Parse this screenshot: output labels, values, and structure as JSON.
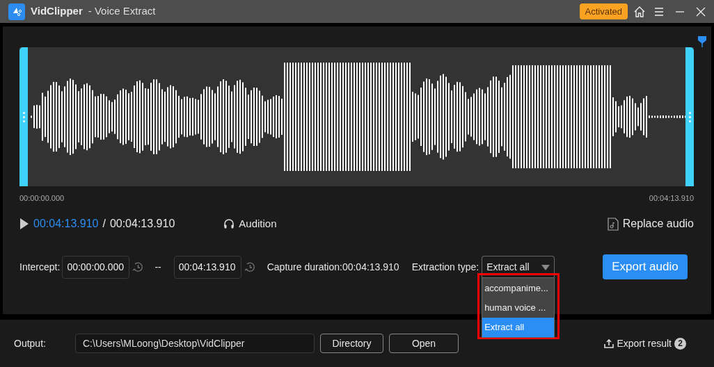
{
  "title_bar": {
    "app_name": "VidClipper",
    "subtitle": "- Voice Extract",
    "badge": "Activated"
  },
  "waveform": {
    "start_time": "00:00:00.000",
    "end_time": "00:04:13.910"
  },
  "playback": {
    "current": "00:04:13.910",
    "separator": "/",
    "total": "00:04:13.910",
    "audition": "Audition",
    "replace_audio": "Replace audio"
  },
  "intercept": {
    "label": "Intercept:",
    "start": "00:00:00.000",
    "dash": "--",
    "end": "00:04:13.910",
    "capture_duration": "Capture duration:00:04:13.910",
    "extraction_label": "Extraction type:",
    "extraction_value": "Extract all",
    "export_button": "Export audio"
  },
  "dropdown_options": [
    {
      "label": "accompanime...",
      "selected": false
    },
    {
      "label": "human voice ...",
      "selected": false
    },
    {
      "label": "Extract all",
      "selected": true
    }
  ],
  "output": {
    "label": "Output:",
    "path": "C:\\Users\\MLoong\\Desktop\\VidClipper",
    "directory_button": "Directory",
    "open_button": "Open",
    "export_result": "Export result",
    "export_count": "2"
  }
}
